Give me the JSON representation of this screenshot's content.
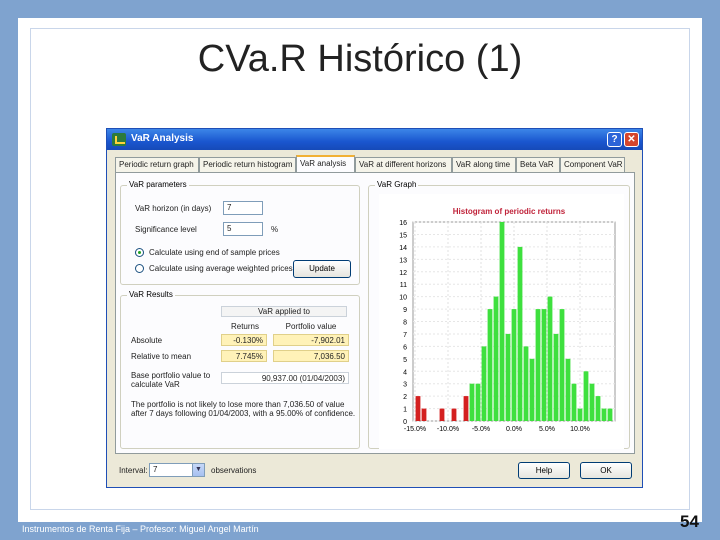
{
  "slide": {
    "title": "CVa.R Histórico (1)",
    "footer": "Instrumentos de Renta Fija – Profesor: Miguel Angel Martín",
    "page_number": "54"
  },
  "window": {
    "title": "VaR Analysis",
    "help_glyph": "?",
    "close_glyph": "✕"
  },
  "tabs": [
    {
      "label": "Periodic return graph",
      "active": false
    },
    {
      "label": "Periodic return histogram",
      "active": false
    },
    {
      "label": "VaR analysis",
      "active": true
    },
    {
      "label": "VaR at different horizons",
      "active": false
    },
    {
      "label": "VaR along time",
      "active": false
    },
    {
      "label": "Beta VaR",
      "active": false
    },
    {
      "label": "Component VaR",
      "active": false
    }
  ],
  "params": {
    "group_title": "VaR parameters",
    "horizon_label": "VaR horizon (in days)",
    "horizon_value": "7",
    "significance_label": "Significance level",
    "significance_value": "5",
    "percent_sign": "%",
    "radio1_label": "Calculate using end of sample prices",
    "radio2_label": "Calculate using average weighted prices",
    "update_button": "Update"
  },
  "results": {
    "group_title": "VaR Results",
    "applied_to": "VaR applied to",
    "col_returns": "Returns",
    "col_portfolio": "Portfolio value",
    "row_absolute": "Absolute",
    "row_relative": "Relative to mean",
    "abs_returns": "-0.130%",
    "abs_portfolio": "-7,902.01",
    "rel_returns": "7.745%",
    "rel_portfolio": "7,036.50",
    "base_label": "Base portfolio value to calculate VaR",
    "base_value": "90,937.00 (01/04/2003)",
    "note": "The portfolio is not likely to lose more than 7,036.50 of value after 7 days following 01/04/2003, with a 95.00% of confidence."
  },
  "graph": {
    "group_title": "VaR Graph"
  },
  "bottom": {
    "interval_label": "Interval:",
    "interval_value": "7",
    "observations_label": "observations",
    "help_button": "Help",
    "ok_button": "OK"
  },
  "chart_data": {
    "type": "bar",
    "title": "Histogram of periodic returns",
    "title_color": "#c0233a",
    "ylim": [
      0,
      16
    ],
    "yticks": [
      "16",
      "15",
      "14",
      "13",
      "12",
      "11",
      "10",
      "9",
      "8",
      "7",
      "6",
      "5",
      "4",
      "3",
      "2",
      "1",
      "0"
    ],
    "xticks": [
      "-15.0%",
      "-10.0%",
      "-5.0%",
      "0.0%",
      "5.0%",
      "10.0%"
    ],
    "colors": {
      "tail": "#d42020",
      "body": "#3ee03e"
    },
    "bins": [
      {
        "value": 2,
        "tail": true
      },
      {
        "value": 1,
        "tail": true
      },
      {
        "value": 0,
        "tail": false
      },
      {
        "value": 0,
        "tail": false
      },
      {
        "value": 1,
        "tail": true
      },
      {
        "value": 0,
        "tail": false
      },
      {
        "value": 1,
        "tail": true
      },
      {
        "value": 0,
        "tail": false
      },
      {
        "value": 2,
        "tail": true
      },
      {
        "value": 3,
        "tail": false
      },
      {
        "value": 3,
        "tail": false
      },
      {
        "value": 6,
        "tail": false
      },
      {
        "value": 9,
        "tail": false
      },
      {
        "value": 10,
        "tail": false
      },
      {
        "value": 16,
        "tail": false
      },
      {
        "value": 7,
        "tail": false
      },
      {
        "value": 9,
        "tail": false
      },
      {
        "value": 14,
        "tail": false
      },
      {
        "value": 6,
        "tail": false
      },
      {
        "value": 5,
        "tail": false
      },
      {
        "value": 9,
        "tail": false
      },
      {
        "value": 9,
        "tail": false
      },
      {
        "value": 10,
        "tail": false
      },
      {
        "value": 7,
        "tail": false
      },
      {
        "value": 9,
        "tail": false
      },
      {
        "value": 5,
        "tail": false
      },
      {
        "value": 3,
        "tail": false
      },
      {
        "value": 1,
        "tail": false
      },
      {
        "value": 4,
        "tail": false
      },
      {
        "value": 3,
        "tail": false
      },
      {
        "value": 2,
        "tail": false
      },
      {
        "value": 1,
        "tail": false
      },
      {
        "value": 1,
        "tail": false
      }
    ]
  }
}
